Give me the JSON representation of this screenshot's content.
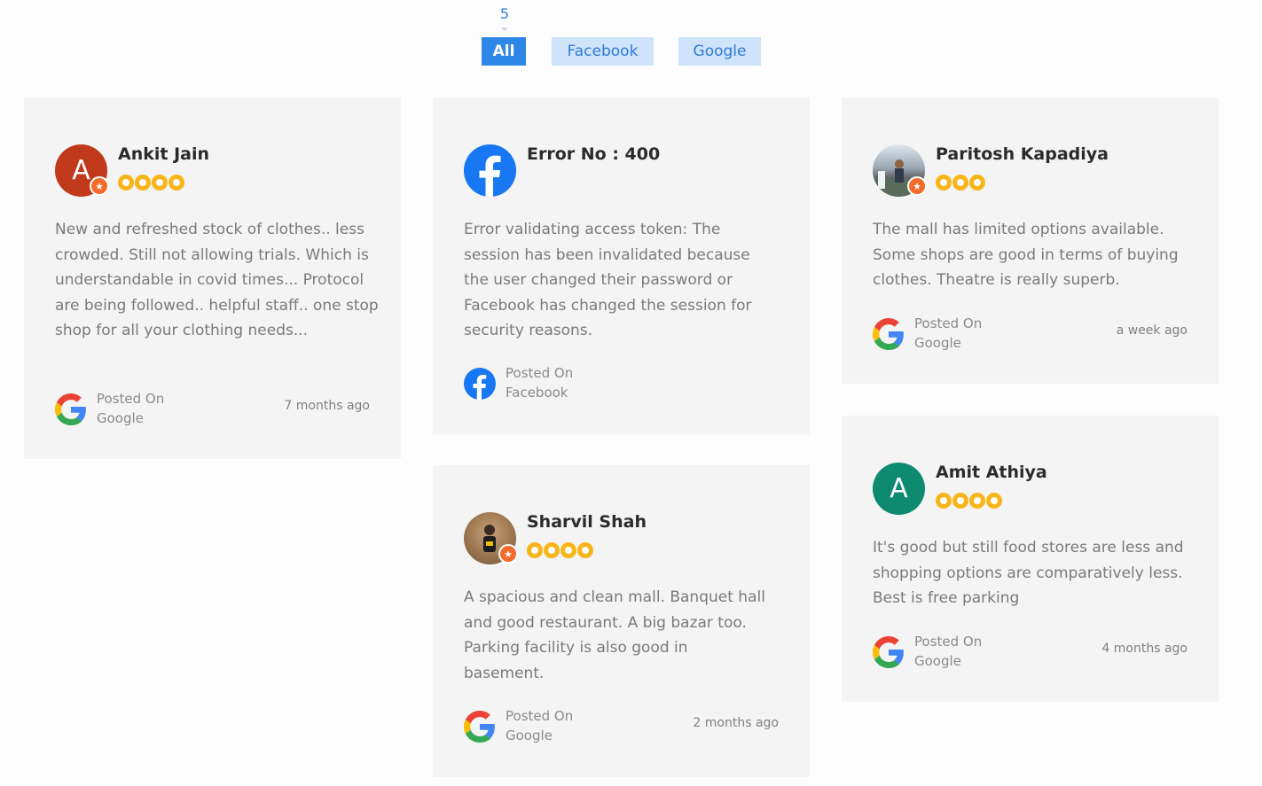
{
  "count": "5",
  "filters": {
    "all": "All",
    "facebook": "Facebook",
    "google": "Google"
  },
  "colors": {
    "accent": "#2d87e6",
    "filter_inactive_bg": "#cfe3fb",
    "star": "#f8b51a",
    "card_bg": "#f4f4f4"
  },
  "reviews": [
    {
      "name": "Ankit Jain",
      "avatar_letter": "A",
      "avatar_color": "#c0391b",
      "rating": 4,
      "text": "New and refreshed stock of clothes.. less crowded. Still not allowing trials. Which is understandable in covid times... Protocol are being followed.. helpful staff.. one stop shop for all your clothing needs...",
      "posted_label": "Posted On",
      "source": "Google",
      "source_icon": "google-icon",
      "time": "7 months ago"
    },
    {
      "name": "Error No : 400",
      "avatar_icon": "facebook-icon",
      "text": "Error validating access token: The session has been invalidated because the user changed their password or Facebook has changed the session for security reasons.",
      "posted_label": "Posted On",
      "source": "Facebook",
      "source_icon": "facebook-icon",
      "time": ""
    },
    {
      "name": "Paritosh Kapadiya",
      "avatar_icon": "user-photo",
      "rating": 3,
      "text": "The mall has limited options available. Some shops are good in terms of buying clothes. Theatre is really superb.",
      "posted_label": "Posted On",
      "source": "Google",
      "source_icon": "google-icon",
      "time": "a week ago"
    },
    {
      "name": "Sharvil Shah",
      "avatar_icon": "user-photo",
      "rating": 4,
      "text": "A spacious and clean mall. Banquet hall and good restaurant. A big bazar too. Parking facility is also good in basement.",
      "posted_label": "Posted On",
      "source": "Google",
      "source_icon": "google-icon",
      "time": "2 months ago"
    },
    {
      "name": "Amit Athiya",
      "avatar_letter": "A",
      "avatar_color": "#0d8a6f",
      "rating": 4,
      "text": "It's good but still food stores are less and shopping options are comparatively less. Best is free parking",
      "posted_label": "Posted On",
      "source": "Google",
      "source_icon": "google-icon",
      "time": "4 months ago"
    }
  ]
}
